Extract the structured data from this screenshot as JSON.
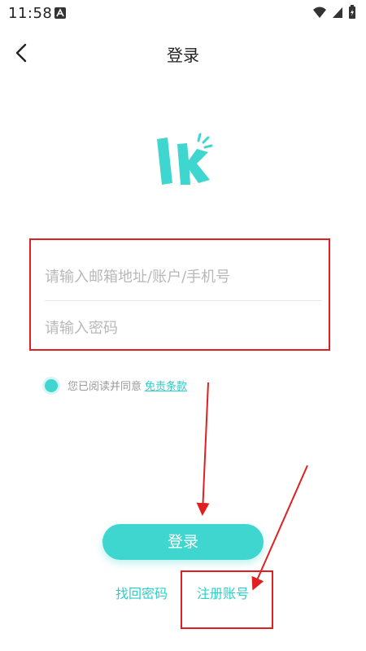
{
  "status_bar": {
    "time": "11:58"
  },
  "header": {
    "title": "登录"
  },
  "form": {
    "username_placeholder": "请输入邮箱地址/账户/手机号",
    "password_placeholder": "请输入密码"
  },
  "agreement": {
    "text": "您已阅读并同意",
    "terms_link": "免责条款"
  },
  "actions": {
    "login_label": "登录",
    "forgot_label": "找回密码",
    "register_label": "注册账号"
  },
  "colors": {
    "accent": "#3ed6cf",
    "annotation": "#e02020"
  }
}
